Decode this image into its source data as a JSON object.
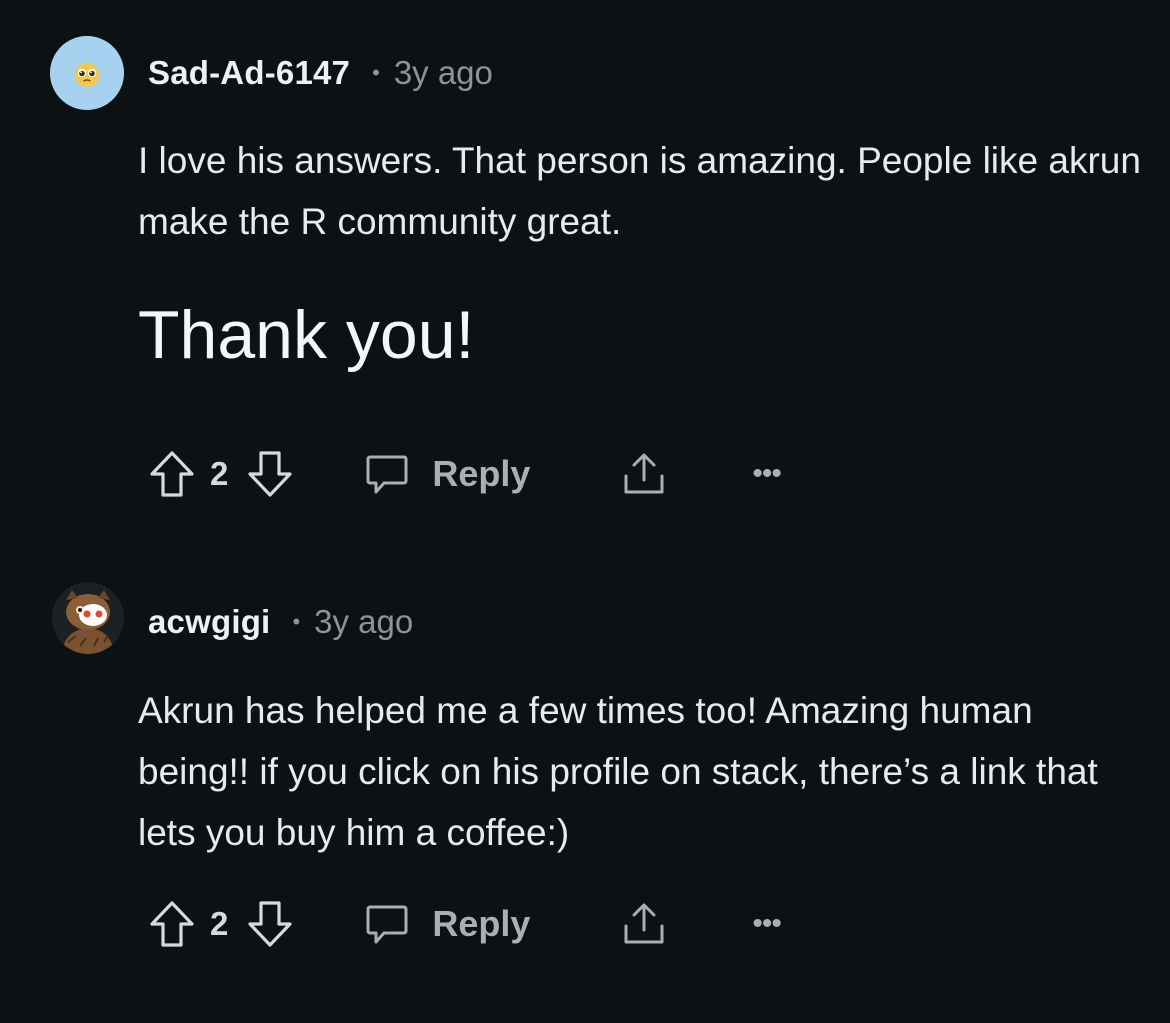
{
  "comments": [
    {
      "username": "Sad-Ad-6147",
      "separator": "•",
      "time": "3y ago",
      "avatar_icon": "pleading-face-icon",
      "body": [
        "I love his answers. That person is amazing. People like akrun make the R community great."
      ],
      "body_large": "Thank you!",
      "votes": "2",
      "reply_label": "Reply",
      "more_label": "•••"
    },
    {
      "username": "acwgigi",
      "separator": "•",
      "time": "3y ago",
      "avatar_icon": "snoo-owl-avatar-icon",
      "body": [
        "Akrun has helped me a few times too! Amazing human being!! if you click on his profile on stack, there’s a link that lets you buy him a coffee:)"
      ],
      "votes": "2",
      "reply_label": "Reply",
      "more_label": "•••"
    }
  ],
  "colors": {
    "background": "#0c1214",
    "text": "#e8ebed",
    "muted": "#8a9499",
    "action": "#a8b0b4",
    "avatar1_bg": "#a7d2ef"
  }
}
